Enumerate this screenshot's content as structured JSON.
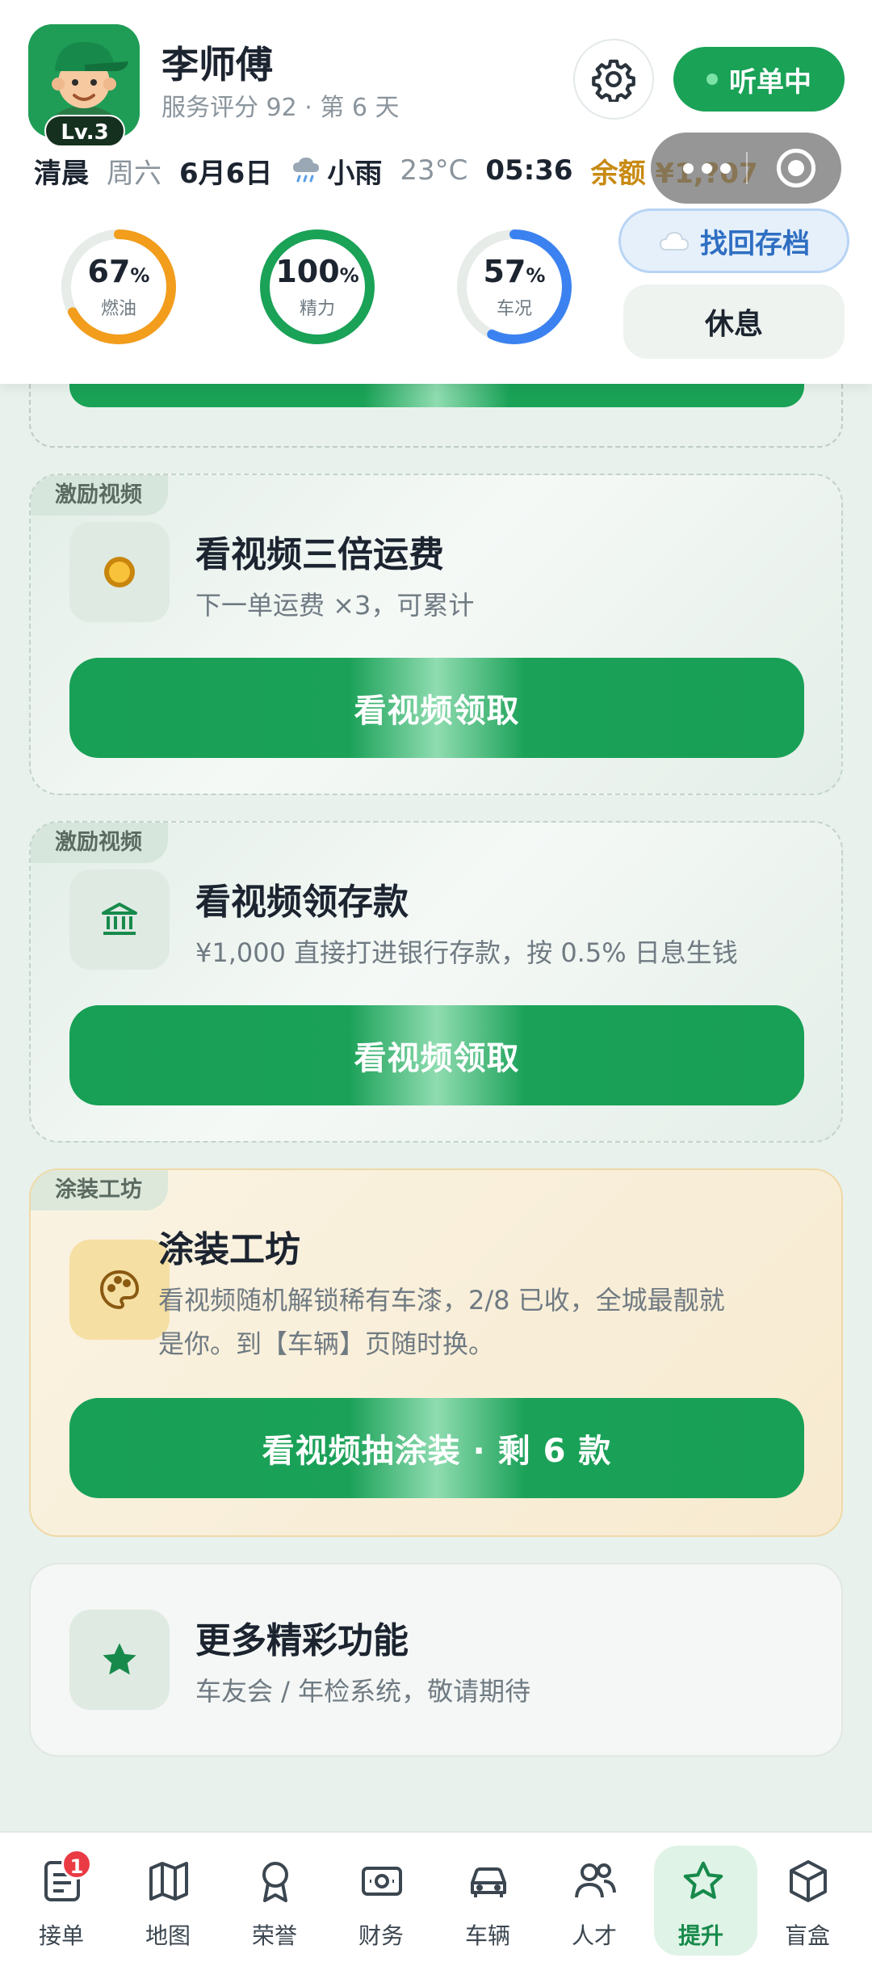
{
  "profile": {
    "name": "李师傅",
    "subinfo": "服务评分 92 · 第 6 天",
    "level": "Lv.3"
  },
  "status": {
    "listening_label": "听单中"
  },
  "infobar": {
    "time_of_day": "清晨",
    "weekday": "周六",
    "date": "6月6日",
    "weather_icon": "rain-cloud-icon",
    "weather": "小雨",
    "temperature": "23°C",
    "clock": "05:36",
    "balance": "余额 ¥1,?07"
  },
  "gauges": [
    {
      "value": "67",
      "unit": "%",
      "label": "燃油",
      "percent": 67,
      "color": "#f29d1c"
    },
    {
      "value": "100",
      "unit": "%",
      "label": "精力",
      "percent": 100,
      "color": "#1aa257"
    },
    {
      "value": "57",
      "unit": "%",
      "label": "车况",
      "percent": 57,
      "color": "#3b82f0"
    }
  ],
  "actions": {
    "recover_label": "找回存档",
    "rest_label": "休息"
  },
  "cards": [
    {
      "tag": "激励视频",
      "title": "看视频三倍运费",
      "desc": "下一单运费 ×3，可累计",
      "button": "看视频领取",
      "icon": "coin-icon"
    },
    {
      "tag": "激励视频",
      "title": "看视频领存款",
      "desc": "¥1,000 直接打进银行存款，按 0.5% 日息生钱",
      "button": "看视频领取",
      "icon": "bank-icon"
    },
    {
      "tag": "涂装工坊",
      "title": "涂装工坊",
      "desc_line1": "看视频随机解锁稀有车漆，2/8 已收，全城最靓就",
      "desc_line2": "是你。到【车辆】页随时换。",
      "button": "看视频抽涂装 · 剩 6 款",
      "icon": "palette-icon"
    },
    {
      "title": "更多精彩功能",
      "desc": "车友会 / 年检系统，敬请期待",
      "icon": "star-icon"
    }
  ],
  "nav": {
    "items": [
      {
        "label": "接单",
        "icon": "orders-icon",
        "badge": "1"
      },
      {
        "label": "地图",
        "icon": "map-icon"
      },
      {
        "label": "荣誉",
        "icon": "award-icon"
      },
      {
        "label": "财务",
        "icon": "money-icon"
      },
      {
        "label": "车辆",
        "icon": "car-icon"
      },
      {
        "label": "人才",
        "icon": "people-icon"
      },
      {
        "label": "提升",
        "icon": "star-outline-icon",
        "active": true
      },
      {
        "label": "盲盒",
        "icon": "box-icon"
      }
    ]
  }
}
